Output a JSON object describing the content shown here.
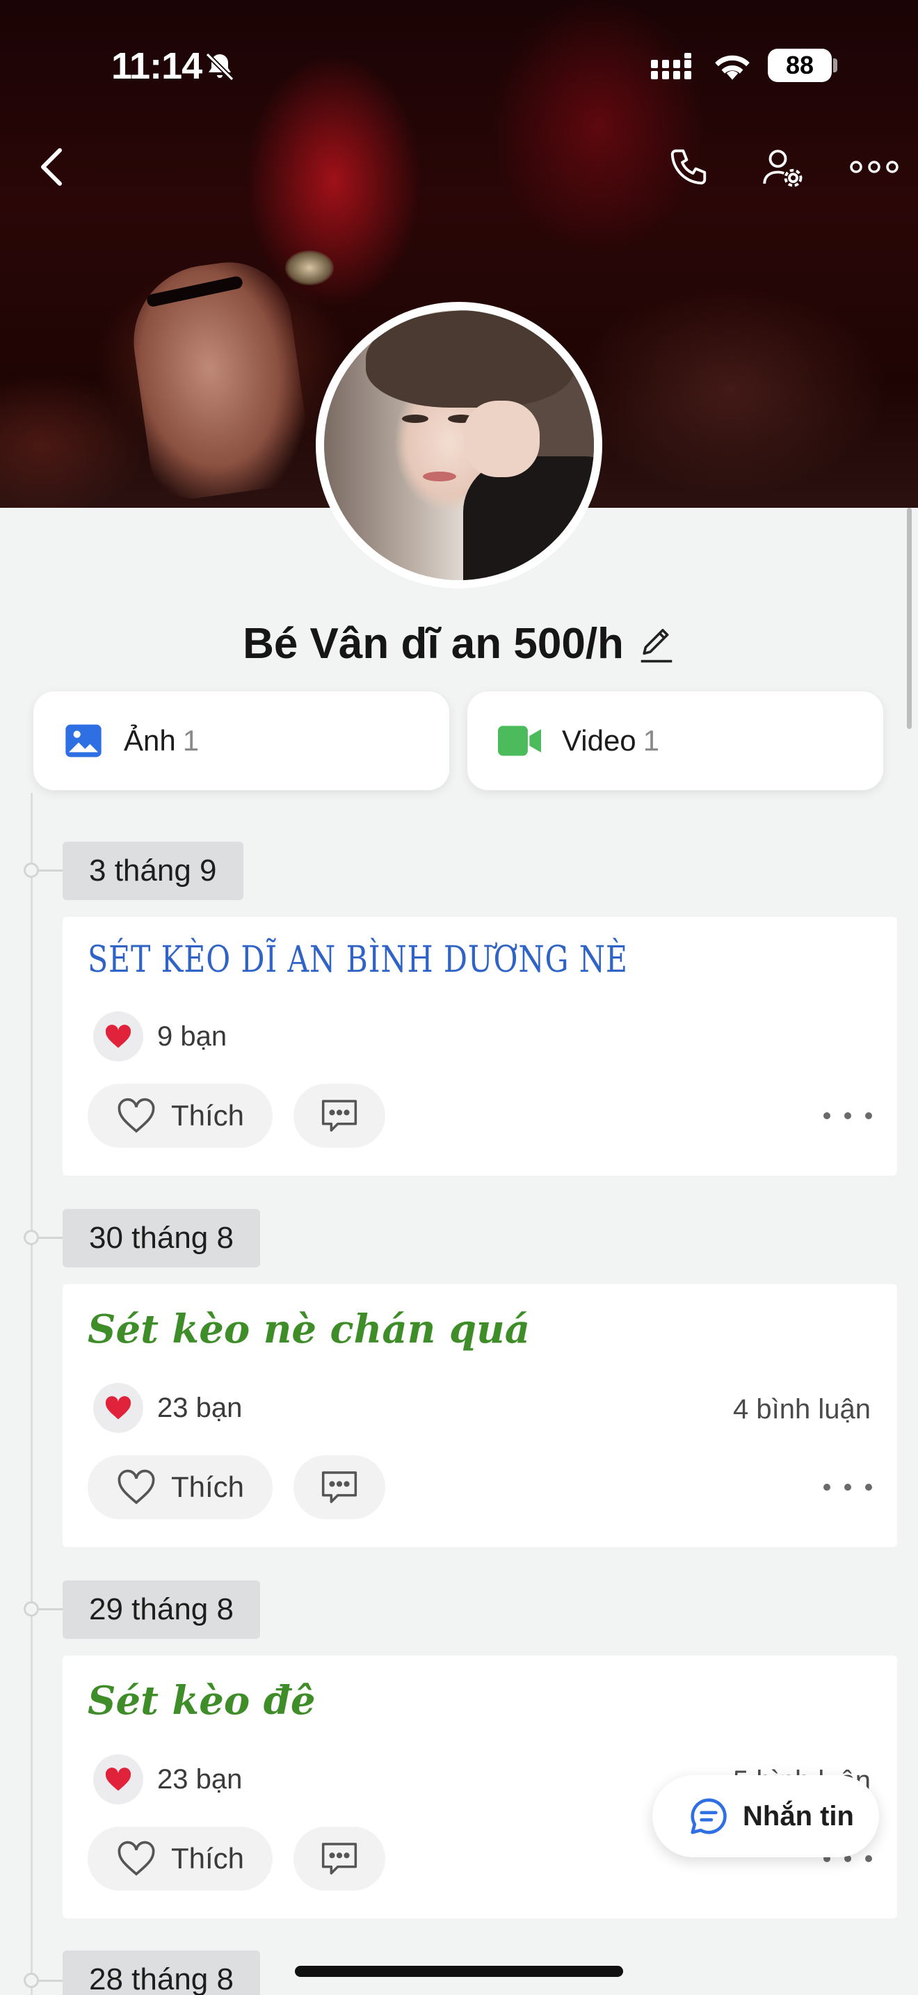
{
  "status_bar": {
    "time": "11:14",
    "battery": "88"
  },
  "profile": {
    "name": "Bé Vân dĩ an 500/h"
  },
  "media": [
    {
      "label": "Ảnh",
      "count": "1"
    },
    {
      "label": "Video",
      "count": "1"
    }
  ],
  "posts": [
    {
      "date": "3 tháng 9",
      "title": "SÉT KÈO DĨ AN BÌNH DƯƠNG NÈ",
      "reactions": "9 bạn",
      "comments": "",
      "like_label": "Thích"
    },
    {
      "date": "30 tháng 8",
      "title": "Sét kèo nè chán quá",
      "reactions": "23 bạn",
      "comments": "4 bình luận",
      "like_label": "Thích"
    },
    {
      "date": "29 tháng 8",
      "title": "Sét kèo đê",
      "reactions": "23 bạn",
      "comments": "5 bình luận",
      "like_label": "Thích"
    },
    {
      "date": "28 tháng 8"
    }
  ],
  "message_button": {
    "label": "Nhắn tin"
  },
  "colors": {
    "accent_blue": "#2f63c6",
    "title_green": "#3e8d28",
    "video_green": "#4cbb5c",
    "heart_red": "#e0233a"
  },
  "icons": [
    "back-icon",
    "phone-icon",
    "user-settings-icon",
    "more-icon",
    "photo-icon",
    "video-icon",
    "edit-icon",
    "heart-icon",
    "comment-icon",
    "message-icon"
  ]
}
